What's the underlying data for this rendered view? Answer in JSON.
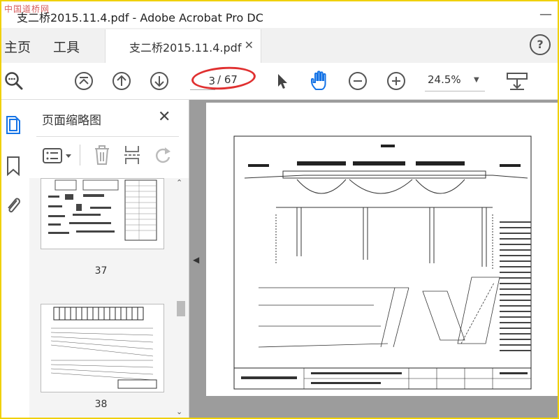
{
  "window": {
    "title": "支二桥2015.11.4.pdf - Adobe Acrobat Pro DC",
    "watermark": "中国道桥网"
  },
  "tabs": {
    "home": "主页",
    "tools": "工具",
    "document": "支二桥2015.11.4.pdf"
  },
  "toolbar": {
    "current_page": "3",
    "total_pages": "/ 67",
    "zoom": "24.5%"
  },
  "thumbnail_panel": {
    "title": "页面缩略图",
    "thumbnails": [
      {
        "page": "37"
      },
      {
        "page": "38"
      }
    ]
  },
  "colors": {
    "accent_blue": "#1473e6",
    "highlight_red": "#e03030",
    "window_border": "#f0d000"
  }
}
